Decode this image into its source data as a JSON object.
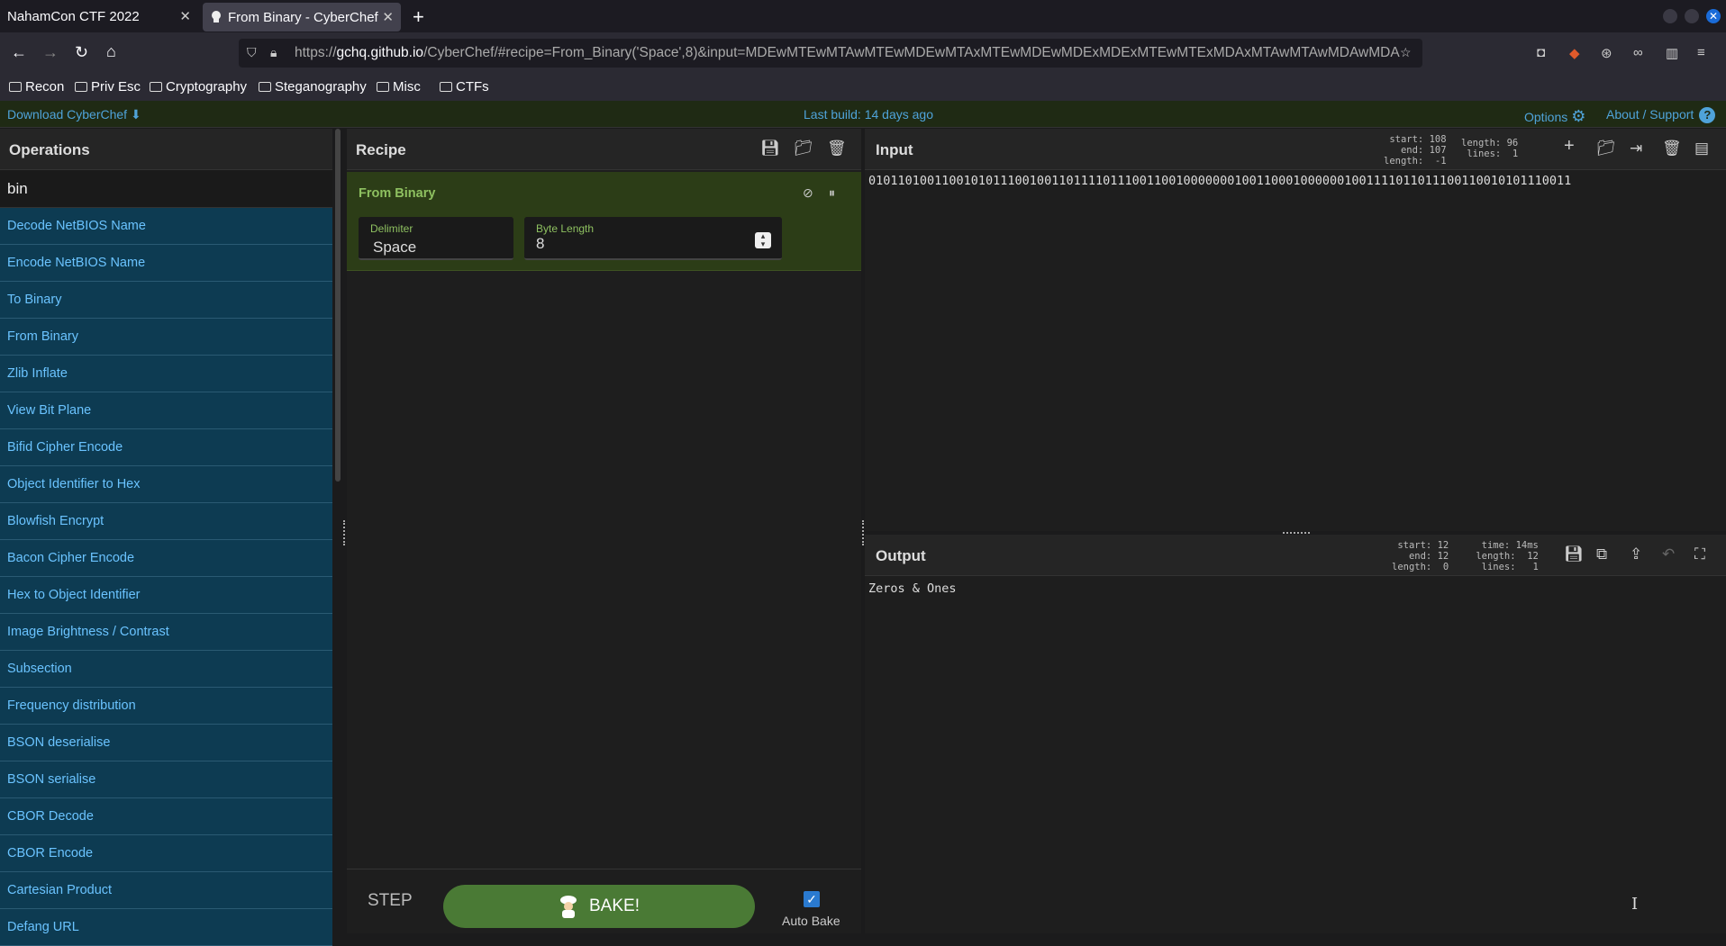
{
  "browser": {
    "tabs": [
      {
        "label": "NahamCon CTF 2022",
        "active": false
      },
      {
        "label": "From Binary - CyberChef",
        "active": true
      }
    ],
    "url_host": "gchq.github.io",
    "url_prefix": "https://",
    "url_path": "/CyberChef/#recipe=From_Binary('Space',8)&input=MDEwMTEwMTAwMTEwMDEwMTAxMTEwMDEwMDExMDExMTEwMTExMDAxMTAwMTAwMDAwMDA",
    "bookmarks": [
      "Recon",
      "Priv Esc",
      "Cryptography",
      "Steganography",
      "Misc",
      "CTFs"
    ]
  },
  "banner": {
    "download": "Download CyberChef",
    "last_build": "Last build: 14 days ago",
    "options": "Options",
    "about": "About / Support"
  },
  "operations": {
    "title": "Operations",
    "search_value": "bin",
    "items": [
      "Decode NetBIOS Name",
      "Encode NetBIOS Name",
      "To Binary",
      "From Binary",
      "Zlib Inflate",
      "View Bit Plane",
      "Bifid Cipher Encode",
      "Object Identifier to Hex",
      "Blowfish Encrypt",
      "Bacon Cipher Encode",
      "Hex to Object Identifier",
      "Image Brightness / Contrast",
      "Subsection",
      "Frequency distribution",
      "BSON deserialise",
      "BSON serialise",
      "CBOR Decode",
      "CBOR Encode",
      "Cartesian Product",
      "Defang URL"
    ]
  },
  "recipe": {
    "title": "Recipe",
    "operation": {
      "name": "From Binary",
      "delimiter_label": "Delimiter",
      "delimiter_value": "Space",
      "byte_length_label": "Byte Length",
      "byte_length_value": "8"
    },
    "step_label": "STEP",
    "bake_label": "BAKE!",
    "auto_bake_label": "Auto Bake",
    "auto_bake_checked": true
  },
  "input": {
    "title": "Input",
    "stats_left": "start: 108\n  end: 107\nlength:  -1",
    "stats_right": "length: 96\n lines:  1",
    "text": "010110100110010101110010011011110111001100100000001001100010000001001111011011100110010101110011"
  },
  "output": {
    "title": "Output",
    "stats_left": "start: 12\n  end: 12\nlength:  0",
    "stats_right": "  time: 14ms\nlength:  12\n lines:   1",
    "text": "Zeros & Ones"
  },
  "colors": {
    "accent_blue": "#4fa3d9",
    "bake_green": "#4a7a35",
    "op_item_bg": "#0d3b52"
  }
}
